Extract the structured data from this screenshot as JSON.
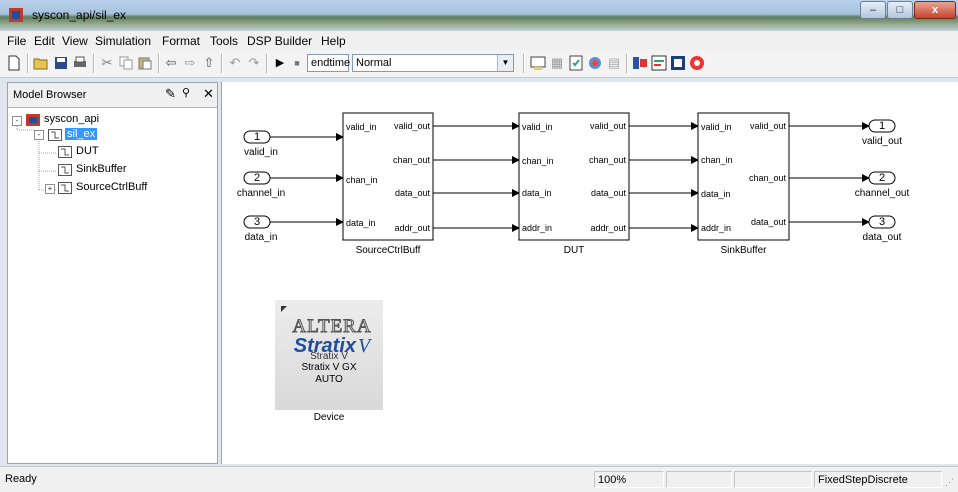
{
  "window": {
    "title": "syscon_api/sil_ex",
    "controls": {
      "minimize": "–",
      "maximize": "□",
      "close": "x"
    }
  },
  "menubar": [
    "File",
    "Edit",
    "View",
    "Simulation",
    "Format",
    "Tools",
    "DSP Builder",
    "Help"
  ],
  "toolbar": {
    "icons": [
      "new-icon",
      "open-icon",
      "save-icon",
      "print-icon",
      "cut-icon",
      "copy-icon",
      "paste-icon",
      "back-icon",
      "forward-icon",
      "up-icon",
      "undo-icon",
      "redo-icon",
      "start-simulation-icon",
      "stop-simulation-icon"
    ],
    "stop_time": "endtime",
    "sim_mode": "Normal",
    "right_icons": [
      "build-icon",
      "library-icon",
      "explorer-icon",
      "debugger-icon",
      "model-icon",
      "signal-icon",
      "report-icon",
      "browser-icon",
      "help-icon"
    ]
  },
  "model_browser": {
    "title": "Model Browser",
    "tree": [
      {
        "label": "syscon_api",
        "expand": "-",
        "level": 0
      },
      {
        "label": "sil_ex",
        "expand": "-",
        "level": 1,
        "selected": true
      },
      {
        "label": "DUT",
        "expand": "",
        "level": 2
      },
      {
        "label": "SinkBuffer",
        "expand": "",
        "level": 2
      },
      {
        "label": "SourceCtrlBuff",
        "expand": "+",
        "level": 2
      }
    ]
  },
  "diagram": {
    "inports": [
      {
        "num": "1",
        "name": "valid_in"
      },
      {
        "num": "2",
        "name": "channel_in"
      },
      {
        "num": "3",
        "name": "data_in"
      }
    ],
    "blocks": [
      {
        "name": "SourceCtrlBuff",
        "in_ports": [
          "valid_in",
          "chan_in",
          "data_in"
        ],
        "out_ports": [
          "valid_out",
          "chan_out",
          "data_out",
          "addr_out"
        ]
      },
      {
        "name": "DUT",
        "in_ports": [
          "valid_in",
          "chan_in",
          "data_in",
          "addr_in"
        ],
        "out_ports": [
          "valid_out",
          "chan_out",
          "data_out",
          "addr_out"
        ]
      },
      {
        "name": "SinkBuffer",
        "in_ports": [
          "valid_in",
          "chan_in",
          "data_in",
          "addr_in"
        ],
        "out_ports": [
          "valid_out",
          "chan_out",
          "data_out"
        ]
      }
    ],
    "outports": [
      {
        "num": "1",
        "name": "valid_out"
      },
      {
        "num": "2",
        "name": "channel_out"
      },
      {
        "num": "3",
        "name": "data_out"
      }
    ],
    "device": {
      "logo": "ALTERA",
      "brand": "Stratix",
      "brand_suffix": "V",
      "line1": "Stratix V",
      "line2": "Stratix V GX",
      "line3": "AUTO",
      "caption": "Device"
    }
  },
  "statusbar": {
    "status": "Ready",
    "zoom": "100%",
    "solver": "FixedStepDiscrete"
  }
}
